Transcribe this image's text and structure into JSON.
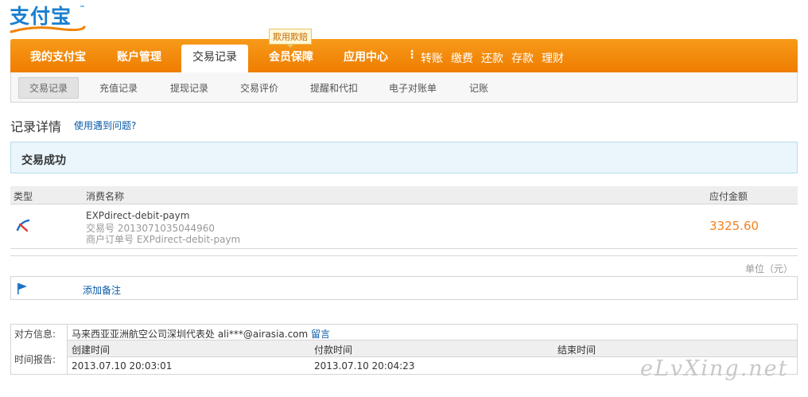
{
  "brand": {
    "logo_text": "支付宝",
    "trademark": "™"
  },
  "nav": {
    "items": [
      {
        "label": "我的支付宝"
      },
      {
        "label": "账户管理"
      },
      {
        "label": "交易记录",
        "active": true
      },
      {
        "label": "会员保障"
      },
      {
        "label": "应用中心"
      }
    ],
    "separator": "⋮",
    "quick_links": [
      "转账",
      "缴费",
      "还款",
      "存款",
      "理财"
    ],
    "promo_tag": "欺用欺赔"
  },
  "subnav": {
    "items": [
      "交易记录",
      "充值记录",
      "提现记录",
      "交易评价",
      "提醒和代扣",
      "电子对账单",
      "记账"
    ]
  },
  "page": {
    "title": "记录详情",
    "help_link": "使用遇到问题?"
  },
  "status": {
    "text": "交易成功"
  },
  "table": {
    "headers": {
      "type": "类型",
      "name": "消费名称",
      "amount": "应付金额"
    },
    "row": {
      "name": "EXPdirect-debit-paym",
      "trade_no": "交易号 2013071035044960",
      "order_no": "商户订单号 EXPdirect-debit-paym",
      "amount": "3325.60"
    },
    "unit": "单位（元）"
  },
  "memo": {
    "link": "添加备注"
  },
  "info": {
    "counterparty_label": "对方信息:",
    "counterparty": "马来西亚亚洲航空公司深圳代表处 ali***@airasia.com",
    "message_link": "留言",
    "time_label": "时间报告:",
    "columns": [
      "创建时间",
      "付款时间",
      "结束时间"
    ],
    "values": [
      "2013.07.10 20:03:01",
      "2013.07.10 20:04:23",
      ""
    ]
  },
  "watermark": "eLvXing.net",
  "colors": {
    "brand_orange": "#ef7d00",
    "amount_orange": "#f77f1c",
    "link_blue": "#0a5aa8",
    "brand_blue": "#1a7fcf"
  }
}
